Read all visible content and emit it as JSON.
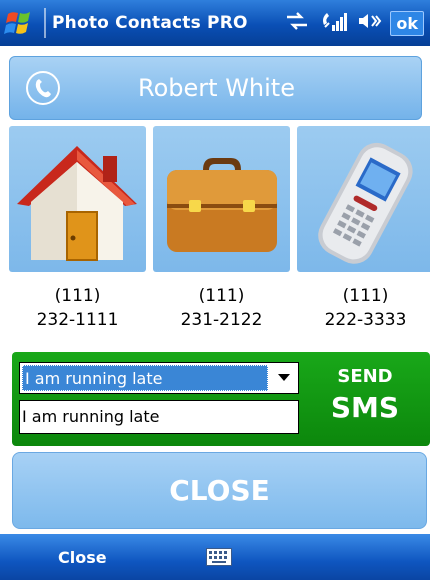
{
  "titlebar": {
    "app_title": "Photo Contacts PRO",
    "ok_label": "ok",
    "icons": [
      "windows-start-icon",
      "connectivity-icon",
      "signal-strength-icon",
      "volume-icon"
    ]
  },
  "contact": {
    "name": "Robert White",
    "header_icon": "phone-handset-icon"
  },
  "tiles": [
    {
      "icon": "home-icon",
      "number_line1": "(111)",
      "number_line2": "232-1111"
    },
    {
      "icon": "briefcase-icon",
      "number_line1": "(111)",
      "number_line2": "231-2122"
    },
    {
      "icon": "mobile-phone-icon",
      "number_line1": "(111)",
      "number_line2": "222-3333"
    }
  ],
  "sms": {
    "template_selected": "I am running late",
    "message_text": "I am running late",
    "send_label": "SEND",
    "sms_label": "SMS"
  },
  "close_label": "CLOSE",
  "softkeys": {
    "left": "Close",
    "center_icon": "keyboard-icon"
  },
  "colors": {
    "title_bar": "#0a4fb5",
    "tile_blue": "#8cc2ee",
    "sms_green": "#129a12",
    "selection_blue": "#3a86d6"
  }
}
